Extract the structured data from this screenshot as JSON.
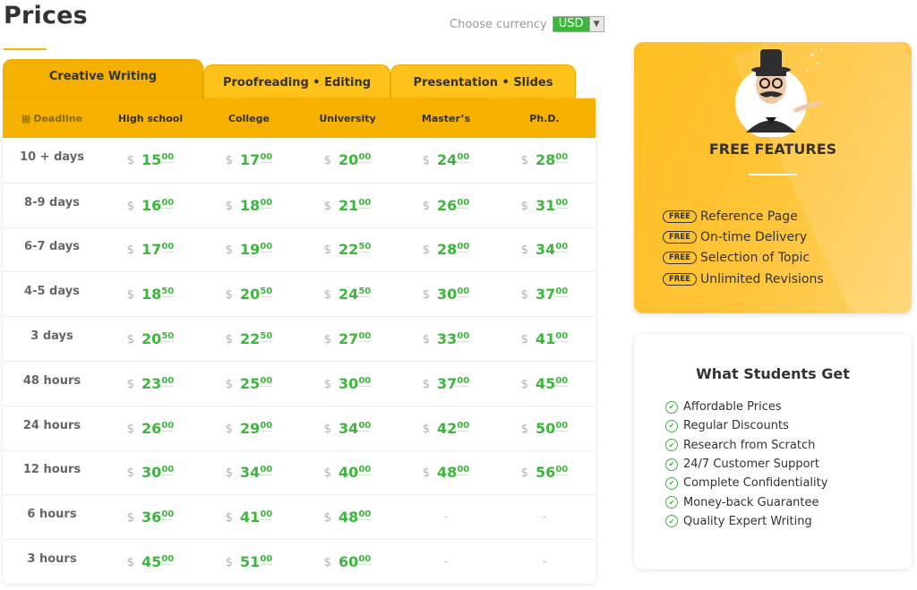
{
  "page": {
    "title": "Prices"
  },
  "currency": {
    "label": "Choose currency",
    "selected": "USD"
  },
  "tabs": [
    {
      "label": "Creative Writing",
      "active": true
    },
    {
      "label": "Proofreading • Editing",
      "active": false
    },
    {
      "label": "Presentation • Slides",
      "active": false
    }
  ],
  "table": {
    "headers": [
      "Deadline",
      "High school",
      "College",
      "University",
      "Master’s",
      "Ph.D."
    ],
    "currency_symbol": "$",
    "rows": [
      {
        "deadline": "10 + days",
        "prices": [
          [
            "15",
            "00"
          ],
          [
            "17",
            "00"
          ],
          [
            "20",
            "00"
          ],
          [
            "24",
            "00"
          ],
          [
            "28",
            "00"
          ]
        ]
      },
      {
        "deadline": "8-9 days",
        "prices": [
          [
            "16",
            "00"
          ],
          [
            "18",
            "00"
          ],
          [
            "21",
            "00"
          ],
          [
            "26",
            "00"
          ],
          [
            "31",
            "00"
          ]
        ]
      },
      {
        "deadline": "6-7 days",
        "prices": [
          [
            "17",
            "00"
          ],
          [
            "19",
            "00"
          ],
          [
            "22",
            "50"
          ],
          [
            "28",
            "00"
          ],
          [
            "34",
            "00"
          ]
        ]
      },
      {
        "deadline": "4-5 days",
        "prices": [
          [
            "18",
            "50"
          ],
          [
            "20",
            "50"
          ],
          [
            "24",
            "50"
          ],
          [
            "30",
            "00"
          ],
          [
            "37",
            "00"
          ]
        ]
      },
      {
        "deadline": "3 days",
        "prices": [
          [
            "20",
            "50"
          ],
          [
            "22",
            "50"
          ],
          [
            "27",
            "00"
          ],
          [
            "33",
            "00"
          ],
          [
            "41",
            "00"
          ]
        ]
      },
      {
        "deadline": "48 hours",
        "prices": [
          [
            "23",
            "00"
          ],
          [
            "25",
            "00"
          ],
          [
            "30",
            "00"
          ],
          [
            "37",
            "00"
          ],
          [
            "45",
            "00"
          ]
        ]
      },
      {
        "deadline": "24 hours",
        "prices": [
          [
            "26",
            "00"
          ],
          [
            "29",
            "00"
          ],
          [
            "34",
            "00"
          ],
          [
            "42",
            "00"
          ],
          [
            "50",
            "00"
          ]
        ]
      },
      {
        "deadline": "12 hours",
        "prices": [
          [
            "30",
            "00"
          ],
          [
            "34",
            "00"
          ],
          [
            "40",
            "00"
          ],
          [
            "48",
            "00"
          ],
          [
            "56",
            "00"
          ]
        ]
      },
      {
        "deadline": "6 hours",
        "prices": [
          [
            "36",
            "00"
          ],
          [
            "41",
            "00"
          ],
          [
            "48",
            "00"
          ],
          null,
          null
        ]
      },
      {
        "deadline": "3 hours",
        "prices": [
          [
            "45",
            "00"
          ],
          [
            "51",
            "00"
          ],
          [
            "60",
            "00"
          ],
          null,
          null
        ]
      }
    ],
    "unavailable": "-"
  },
  "free_features": {
    "title": "FREE FEATURES",
    "badge": "FREE",
    "items": [
      "Reference Page",
      "On-time Delivery",
      "Selection of Topic",
      "Unlimited Revisions"
    ]
  },
  "students": {
    "title": "What Students Get",
    "items": [
      "Affordable Prices",
      "Regular Discounts",
      "Research from Scratch",
      "24/7 Customer Support",
      "Complete Confidentiality",
      "Money-back Guarantee",
      "Quality Expert Writing"
    ]
  },
  "colors": {
    "accent": "#f5b000",
    "price_green": "#3eb63e"
  },
  "icons": {
    "deadline": "calendar-icon",
    "feature": "free-badge",
    "student_item": "check-circle-icon",
    "mascot": "professor-mascot"
  }
}
